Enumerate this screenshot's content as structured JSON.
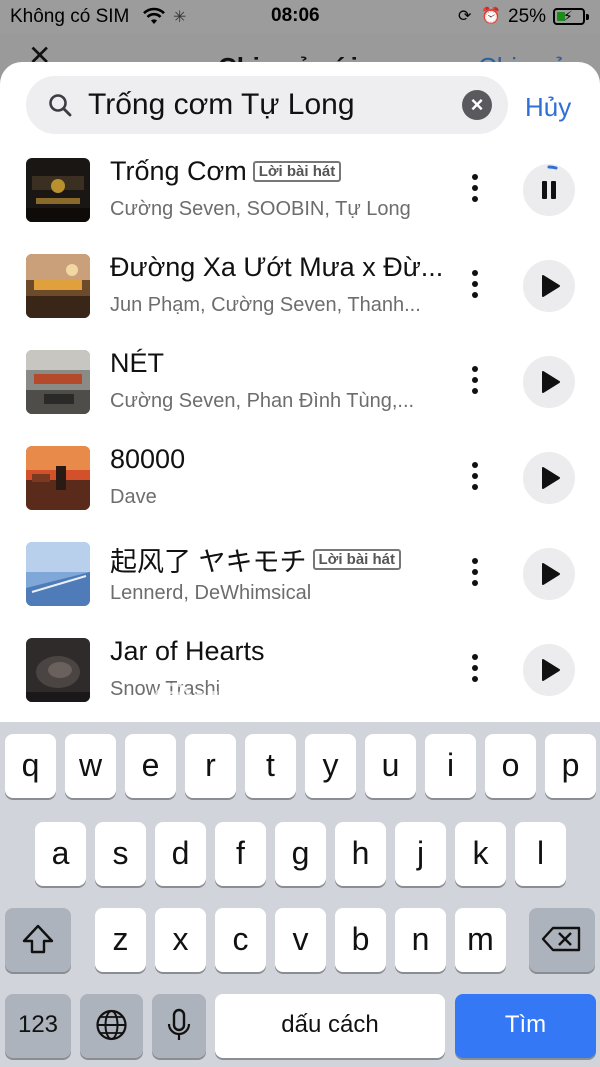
{
  "status_bar": {
    "carrier": "Không có SIM",
    "time": "08:06",
    "battery": "25%"
  },
  "background_header": {
    "title": "Chia sẻ với",
    "action": "Chia sẻ"
  },
  "search": {
    "value": "Trống cơm Tự Long",
    "cancel_label": "Hủy"
  },
  "results": [
    {
      "title": "Trống Cơm",
      "badge": "Lời bài hát",
      "artist": "Cường Seven, SOOBIN, Tự Long",
      "state": "pause"
    },
    {
      "title": "Đường Xa Ướt Mưa x Đừ...",
      "badge": "",
      "artist": "Jun Phạm, Cường Seven, Thanh...",
      "state": "play"
    },
    {
      "title": "NÉT",
      "badge": "",
      "artist": "Cường Seven, Phan Đình Tùng,...",
      "state": "play"
    },
    {
      "title": "80000",
      "badge": "",
      "artist": "Dave",
      "state": "play"
    },
    {
      "title": "起风了 ヤキモチ",
      "badge": "Lời bài hát",
      "artist": "Lennerd, DeWhimsical",
      "state": "play"
    },
    {
      "title": "Jar of Hearts",
      "badge": "",
      "artist": "Snow Trashi",
      "state": "play"
    }
  ],
  "watermark": "@uantrimang",
  "keyboard": {
    "row1": [
      "q",
      "w",
      "e",
      "r",
      "t",
      "y",
      "u",
      "i",
      "o",
      "p"
    ],
    "row2": [
      "a",
      "s",
      "d",
      "f",
      "g",
      "h",
      "j",
      "k",
      "l"
    ],
    "row3": [
      "z",
      "x",
      "c",
      "v",
      "b",
      "n",
      "m"
    ],
    "numbers_label": "123",
    "space_label": "dấu cách",
    "search_label": "Tìm"
  }
}
